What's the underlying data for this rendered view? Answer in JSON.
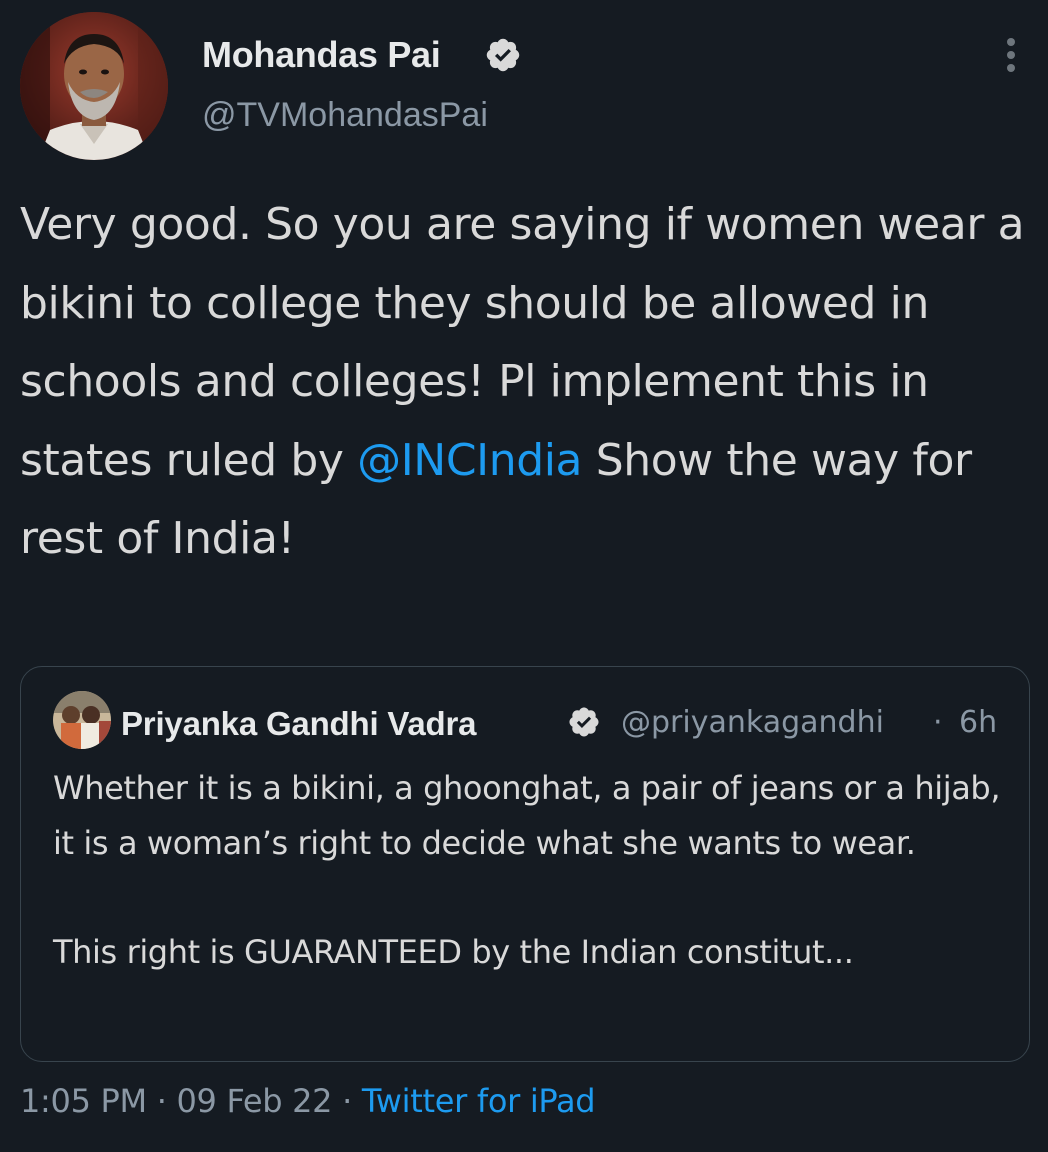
{
  "author": {
    "name": "Mohandas Pai",
    "handle": "@TVMohandasPai",
    "verified": true
  },
  "tweet": {
    "text_before": "Very good. So you are saying if women wear a bikini to college they should be allowed in schools and colleges! Pl implement this in states ruled by ",
    "mention": "@INCIndia",
    "text_after": " Show the way for rest of India!"
  },
  "quoted_tweet": {
    "name": "Priyanka Gandhi Vadra",
    "verified": true,
    "handle": "@priyankagandhi",
    "separator": "·",
    "time": "6h",
    "paragraph_1": "Whether it is a bikini, a ghoonghat, a pair of jeans or a hijab, it is a woman’s right to decide what she wants to wear.",
    "paragraph_2": "This right is GUARANTEED by the Indian constitut..."
  },
  "meta": {
    "time": "1:05 PM",
    "separator": "·",
    "date": "09 Feb 22",
    "source": "Twitter for iPad"
  },
  "icons": {
    "verified": "verified-badge-icon",
    "more": "more-vertical-icon"
  },
  "colors": {
    "background": "#151b22",
    "link": "#1d9bf0",
    "secondary_text": "#8b98a5",
    "primary_text": "#d9d9d9",
    "border": "#38444d"
  }
}
